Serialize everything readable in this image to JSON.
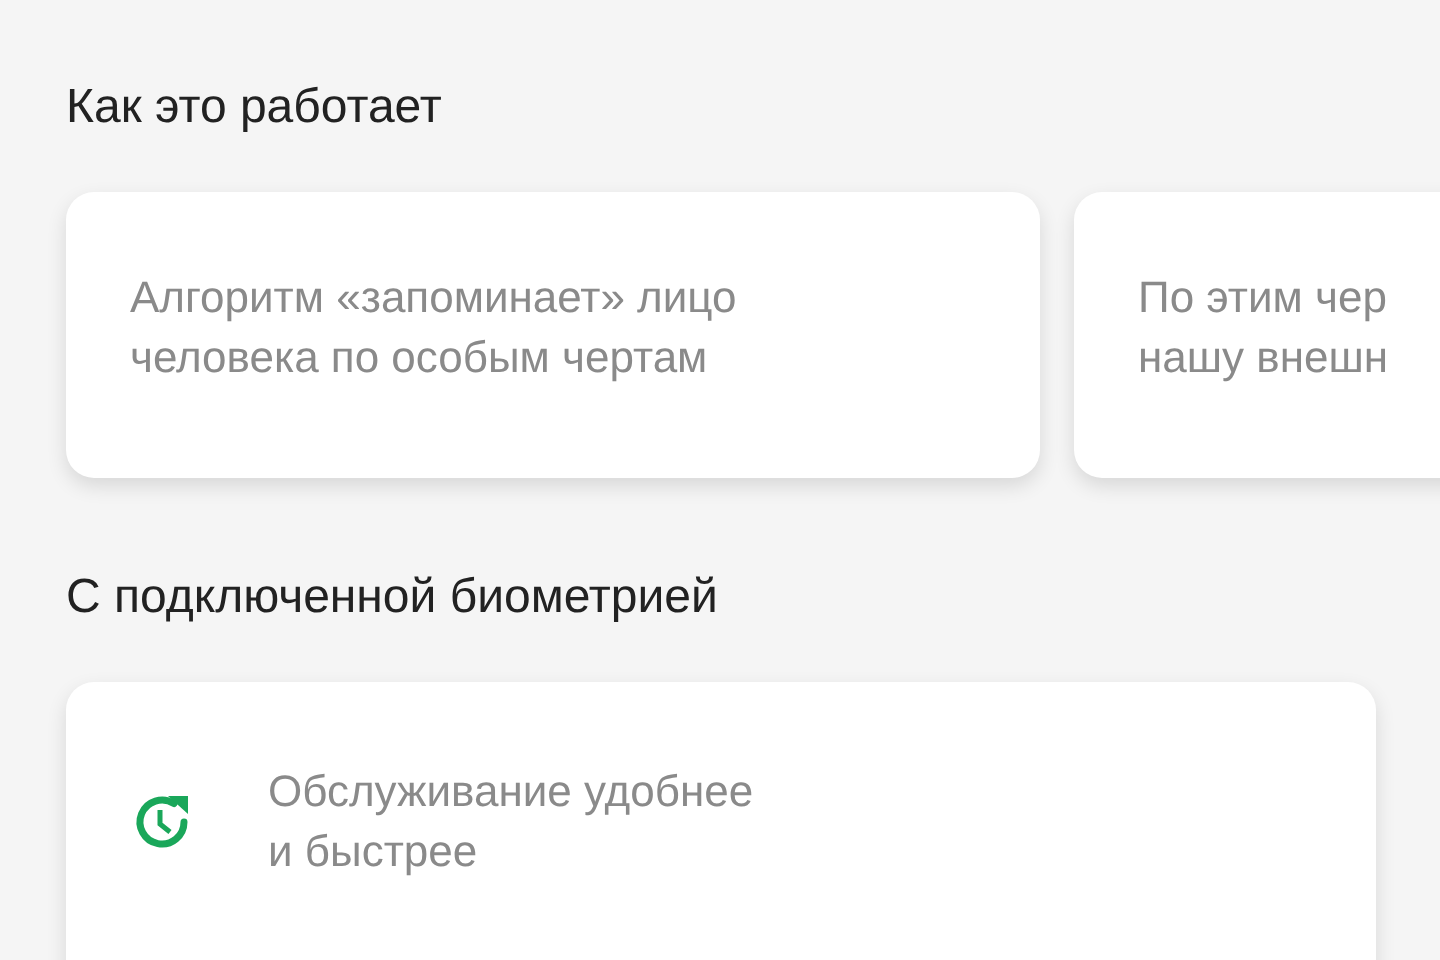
{
  "sections": [
    {
      "title": "Как это работает",
      "cards": [
        {
          "kind": "text",
          "lines": [
            "Алгоритм «запоминает» лицо",
            "человека по особым чертам"
          ]
        },
        {
          "kind": "text",
          "lines": [
            "По этим чер",
            "нашу внешн"
          ]
        }
      ]
    },
    {
      "title": "С подключенной биометрией",
      "cards": [
        {
          "kind": "icon",
          "lines": [
            "Обслуживание удобнее",
            "и быстрее"
          ]
        }
      ]
    }
  ]
}
